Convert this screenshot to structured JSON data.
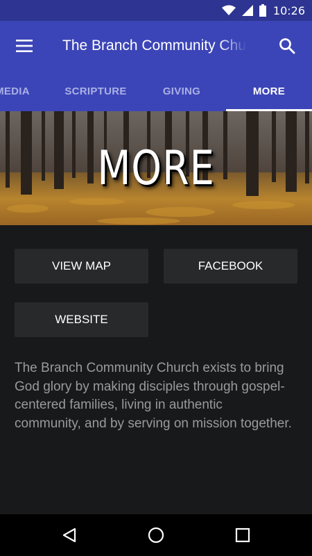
{
  "status_bar": {
    "time": "10:26",
    "icons": [
      "wifi-icon",
      "cell-signal-icon",
      "battery-icon"
    ]
  },
  "app_bar": {
    "title": "The Branch Community Church",
    "menu_icon": "hamburger-menu-icon",
    "search_icon": "search-icon"
  },
  "tabs": [
    {
      "label": "MEDIA",
      "active": false
    },
    {
      "label": "SCRIPTURE",
      "active": false
    },
    {
      "label": "GIVING",
      "active": false
    },
    {
      "label": "MORE",
      "active": true
    }
  ],
  "hero": {
    "title": "MORE"
  },
  "buttons": {
    "view_map": "VIEW MAP",
    "facebook": "FACEBOOK",
    "website": "WEBSITE"
  },
  "about_text": "The Branch Community Church exists to bring God glory by making disciples through gospel-centered families, living in authentic community, and by serving on mission together.",
  "nav_bar": {
    "back_icon": "back-triangle-icon",
    "home_icon": "home-circle-icon",
    "recents_icon": "recents-square-icon"
  },
  "colors": {
    "app_bar": "#3c45b7",
    "status_bar": "#2d3491",
    "background": "#18191b",
    "button": "#28292b"
  }
}
